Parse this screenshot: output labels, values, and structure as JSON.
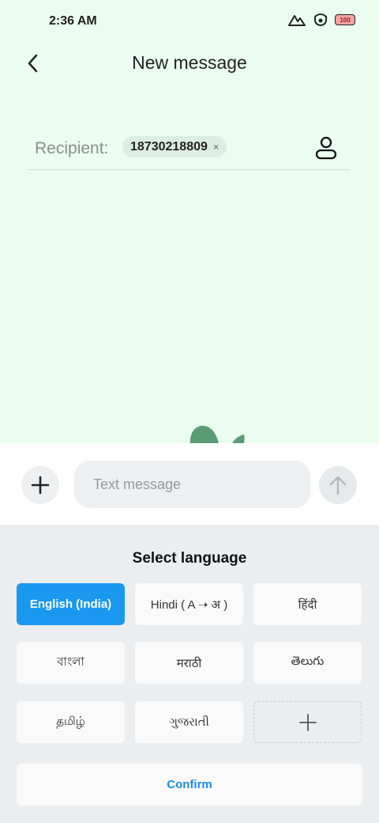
{
  "status_bar": {
    "time": "2:36 AM",
    "battery": "100",
    "battery_color": "#f4a3a3"
  },
  "header": {
    "title": "New message"
  },
  "recipient": {
    "label": "Recipient:",
    "chips": [
      {
        "number": "18730218809",
        "remove": "×"
      }
    ]
  },
  "composer": {
    "placeholder": "Text message"
  },
  "language_panel": {
    "title": "Select language",
    "languages": [
      {
        "label": "English (India)",
        "selected": true
      },
      {
        "label": "Hindi ( A ➝ अ )",
        "selected": false
      },
      {
        "label": "हिंदी",
        "selected": false
      },
      {
        "label": "বাংলা",
        "selected": false
      },
      {
        "label": "मराठी",
        "selected": false
      },
      {
        "label": "తెలుగు",
        "selected": false
      },
      {
        "label": "தமிழ்",
        "selected": false
      },
      {
        "label": "ગુજરાતી",
        "selected": false
      }
    ],
    "confirm_label": "Confirm"
  },
  "colors": {
    "accent": "#1a98f0",
    "background_top": "#eafdf0",
    "panel": "#ebeef1"
  },
  "icons": [
    "back-arrow-icon",
    "contact-icon",
    "plus-icon",
    "send-arrow-icon",
    "signal-icon",
    "hotspot-icon",
    "battery-icon",
    "add-language-icon"
  ]
}
